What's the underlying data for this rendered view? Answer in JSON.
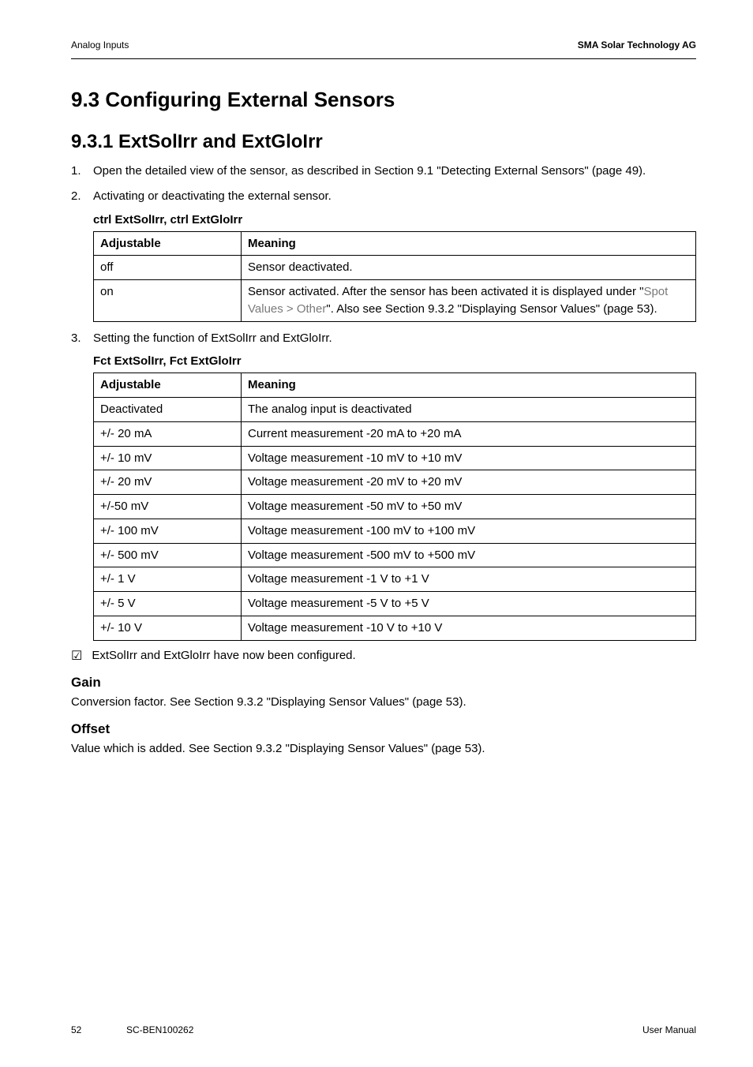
{
  "header": {
    "left": "Analog Inputs",
    "right": "SMA Solar Technology AG"
  },
  "sections": {
    "s93": "9.3  Configuring External Sensors",
    "s931": "9.3.1  ExtSolIrr and ExtGloIrr"
  },
  "steps1": [
    "Open the detailed view of the sensor, as described in Section 9.1 \"Detecting External Sensors\" (page 49).",
    "Activating or deactivating the external sensor."
  ],
  "param1_head": "ctrl ExtSolIrr, ctrl ExtGloIrr",
  "table1": {
    "headers": [
      "Adjustable",
      "Meaning"
    ],
    "rows": [
      {
        "c0": "off",
        "c1": "Sensor deactivated."
      },
      {
        "c0": "on",
        "c1_pre": "Sensor activated. After the sensor has been activated it is displayed under \"",
        "c1_gray": "Spot Values > Other",
        "c1_post": "\". Also see Section 9.3.2 \"Displaying Sensor Values\" (page 53)."
      }
    ]
  },
  "step3": "Setting the function of ExtSolIrr and ExtGloIrr.",
  "param2_head": "Fct ExtSolIrr, Fct ExtGloIrr",
  "table2": {
    "headers": [
      "Adjustable",
      "Meaning"
    ],
    "rows": [
      [
        "Deactivated",
        "The analog input is deactivated"
      ],
      [
        "+/- 20 mA",
        "Current measurement -20 mA to +20 mA"
      ],
      [
        "+/- 10 mV",
        "Voltage measurement -10 mV to +10 mV"
      ],
      [
        "+/- 20 mV",
        "Voltage measurement -20 mV to +20 mV"
      ],
      [
        "+/-50 mV",
        "Voltage measurement -50 mV to +50 mV"
      ],
      [
        "+/- 100 mV",
        "Voltage measurement -100 mV to +100 mV"
      ],
      [
        "+/- 500 mV",
        "Voltage measurement -500 mV to +500 mV"
      ],
      [
        "+/- 1 V",
        "Voltage measurement -1 V to +1 V"
      ],
      [
        "+/- 5 V",
        "Voltage measurement -5 V to +5 V"
      ],
      [
        "+/- 10 V",
        "Voltage measurement -10 V to +10 V"
      ]
    ]
  },
  "check_result": "ExtSolIrr and ExtGloIrr have now been configured.",
  "gain_head": "Gain",
  "gain_body": "Conversion factor. See Section 9.3.2 \"Displaying Sensor Values\" (page 53).",
  "offset_head": "Offset",
  "offset_body": "Value which is added. See Section 9.3.2 \"Displaying Sensor Values\" (page 53).",
  "footer": {
    "page": "52",
    "doc": "SC-BEN100262",
    "right": "User Manual"
  },
  "checkmark": "☑"
}
